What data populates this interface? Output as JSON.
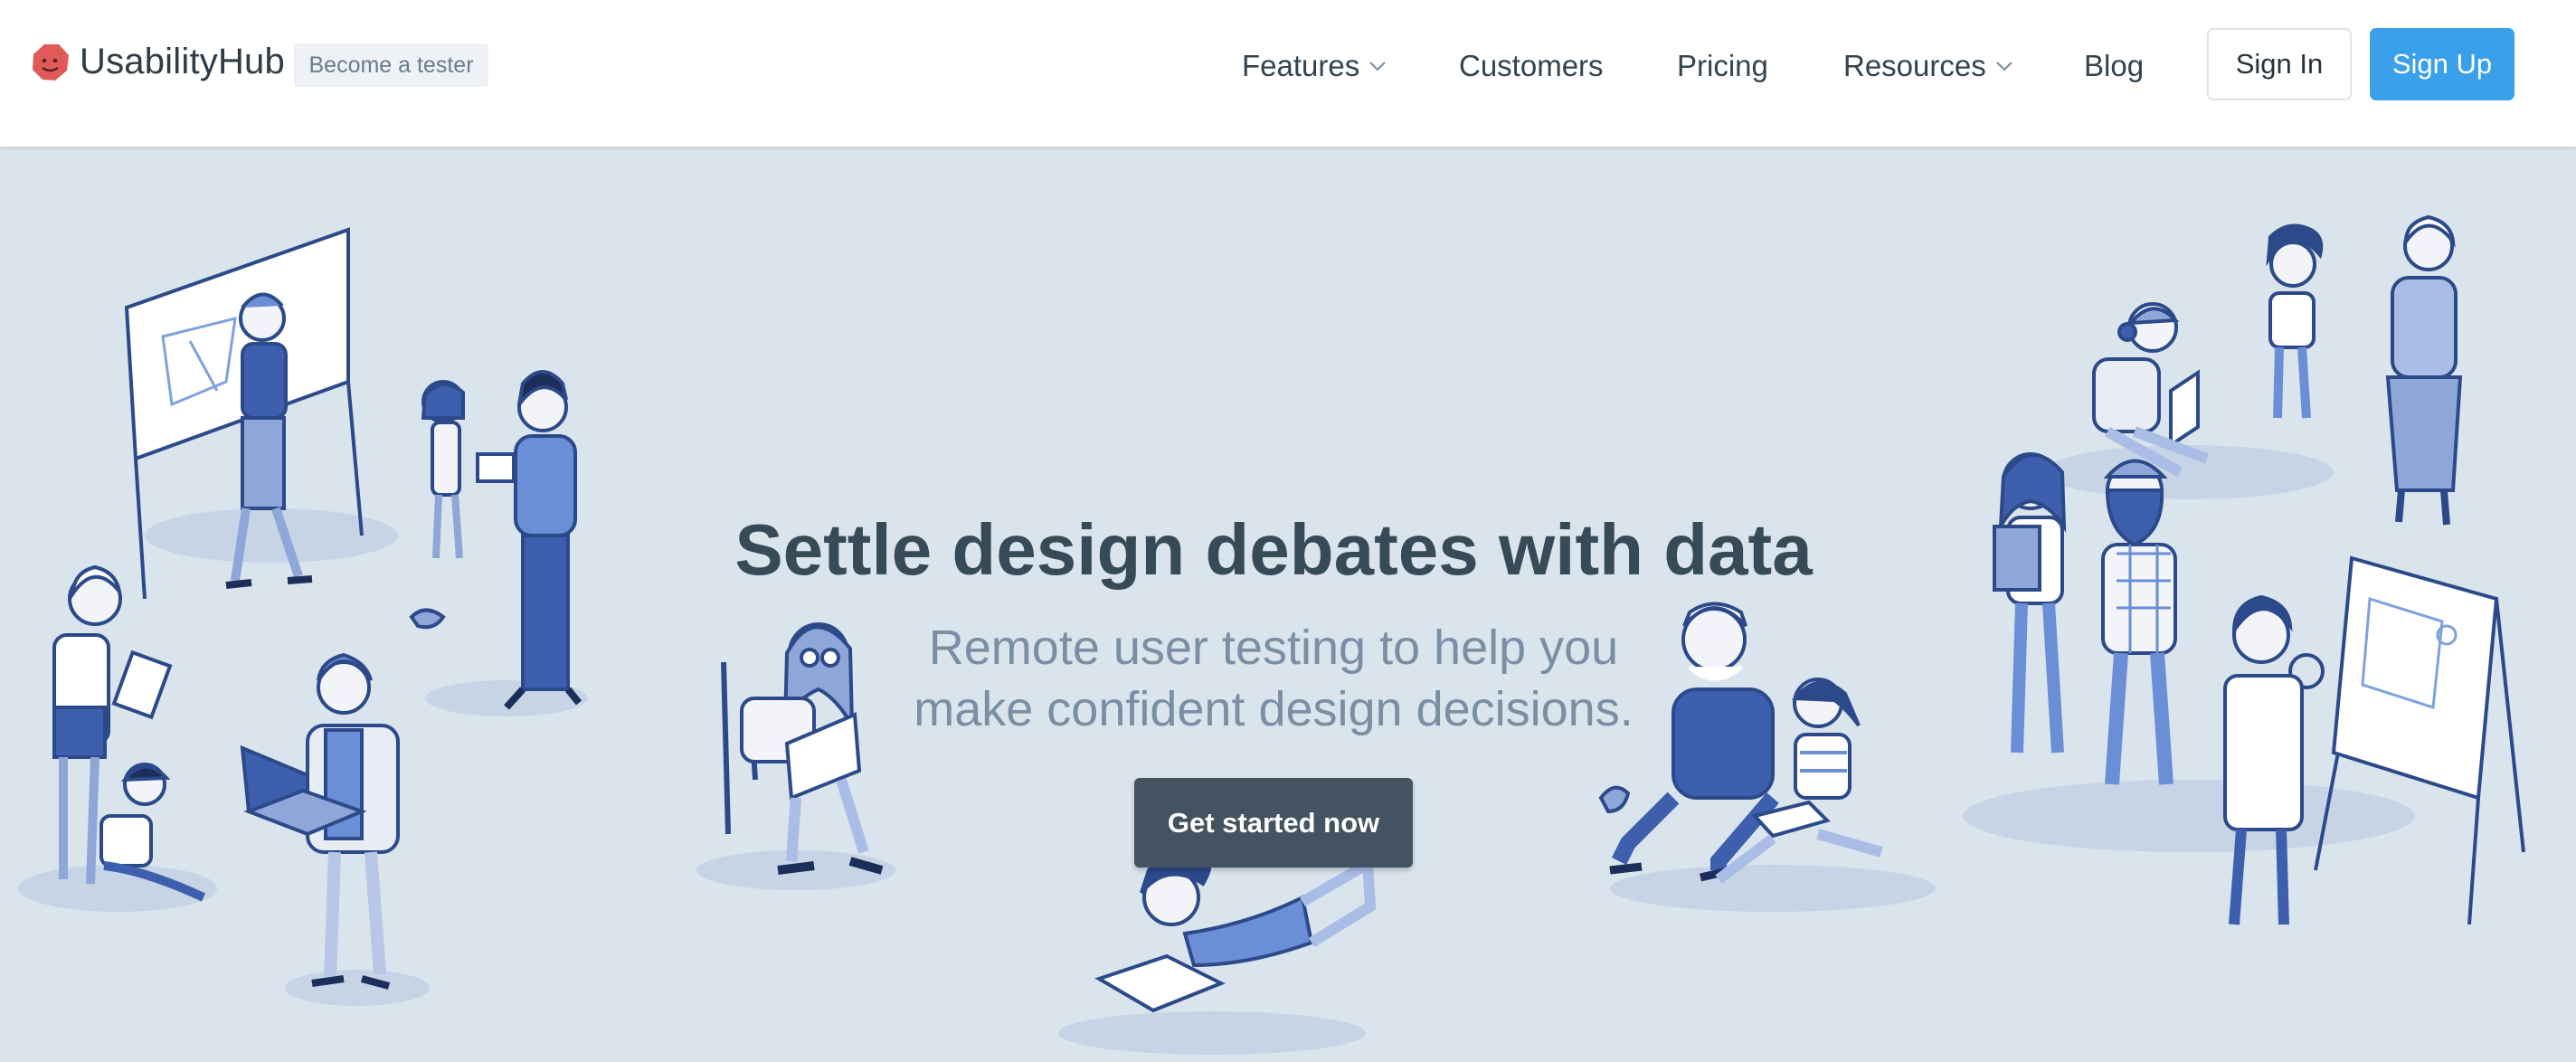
{
  "brand": {
    "name": "UsabilityHub",
    "tester_badge": "Become a tester"
  },
  "nav": {
    "features": "Features",
    "customers": "Customers",
    "pricing": "Pricing",
    "resources": "Resources",
    "blog": "Blog",
    "sign_in": "Sign In",
    "sign_up": "Sign Up"
  },
  "hero": {
    "headline": "Settle design debates with data",
    "subhead_line1": "Remote user testing to help you",
    "subhead_line2": "make confident design decisions.",
    "cta": "Get started now"
  },
  "colors": {
    "brand_red": "#e05a5a",
    "primary_blue": "#3ba0ea",
    "hero_bg": "#dae4ec",
    "cta_bg": "#435361",
    "headline": "#364a57",
    "subhead": "#7b8fa4"
  }
}
